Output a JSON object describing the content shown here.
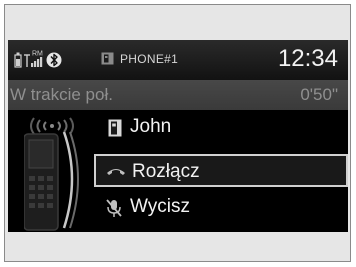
{
  "status_bar": {
    "roaming_indicator": "RM",
    "phone_label": "PHONE#1",
    "clock": "12:34"
  },
  "call": {
    "status_label": "W trakcie poł.",
    "duration": "0'50\"",
    "contact_name": "John"
  },
  "menu": {
    "items": [
      {
        "label": "Rozłącz",
        "icon": "hang-up-icon",
        "selected": true
      },
      {
        "label": "Wycisz",
        "icon": "mute-microphone-icon",
        "selected": false
      }
    ]
  },
  "colors": {
    "screen_background": "#000000",
    "text_primary": "#f2f2f2",
    "text_dim": "#8f8f8f",
    "selection_border": "#d0d0d0"
  }
}
